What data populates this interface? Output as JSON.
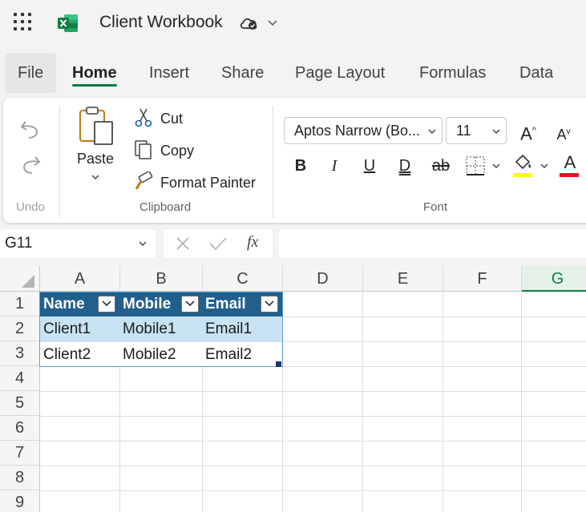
{
  "titlebar": {
    "app_title": "Client Workbook",
    "icons": [
      "app-launcher-icon",
      "excel-logo-icon",
      "cloud-saved-icon",
      "chevron-down-icon"
    ]
  },
  "tabs": [
    {
      "label": "File"
    },
    {
      "label": "Home",
      "active": true
    },
    {
      "label": "Insert"
    },
    {
      "label": "Share"
    },
    {
      "label": "Page Layout"
    },
    {
      "label": "Formulas"
    },
    {
      "label": "Data"
    }
  ],
  "ribbon": {
    "undo_group": {
      "label": "Undo"
    },
    "clipboard": {
      "paste_label": "Paste",
      "cut_label": "Cut",
      "copy_label": "Copy",
      "format_painter_label": "Format Painter",
      "group_label": "Clipboard"
    },
    "font": {
      "font_name": "Aptos Narrow (Bo...",
      "font_size": "11",
      "group_label": "Font",
      "increase_size_glyph": "A",
      "decrease_size_glyph": "A",
      "bold_glyph": "B",
      "italic_glyph": "I",
      "underline_glyph": "U",
      "double_underline_glyph": "D",
      "strikethrough_glyph": "ab",
      "font_color_glyph": "A",
      "highlight_color": "#ffff00",
      "font_color": "#e81123"
    }
  },
  "formula_bar": {
    "name_box": "G11",
    "fx_label": "fx",
    "formula": ""
  },
  "grid": {
    "columns": [
      "A",
      "B",
      "C",
      "D",
      "E",
      "F",
      "G"
    ],
    "selected_column": "G",
    "rows": [
      "1",
      "2",
      "3",
      "4",
      "5",
      "6",
      "7",
      "8",
      "9"
    ],
    "table": {
      "headers": [
        "Name",
        "Mobile",
        "Email"
      ],
      "rows": [
        [
          "Client1",
          "Mobile1",
          "Email1"
        ],
        [
          "Client2",
          "Mobile2",
          "Email2"
        ]
      ],
      "header_color": "#215f8c",
      "band_color": "#c7e3f4"
    }
  },
  "colors": {
    "accent": "#107c41"
  }
}
